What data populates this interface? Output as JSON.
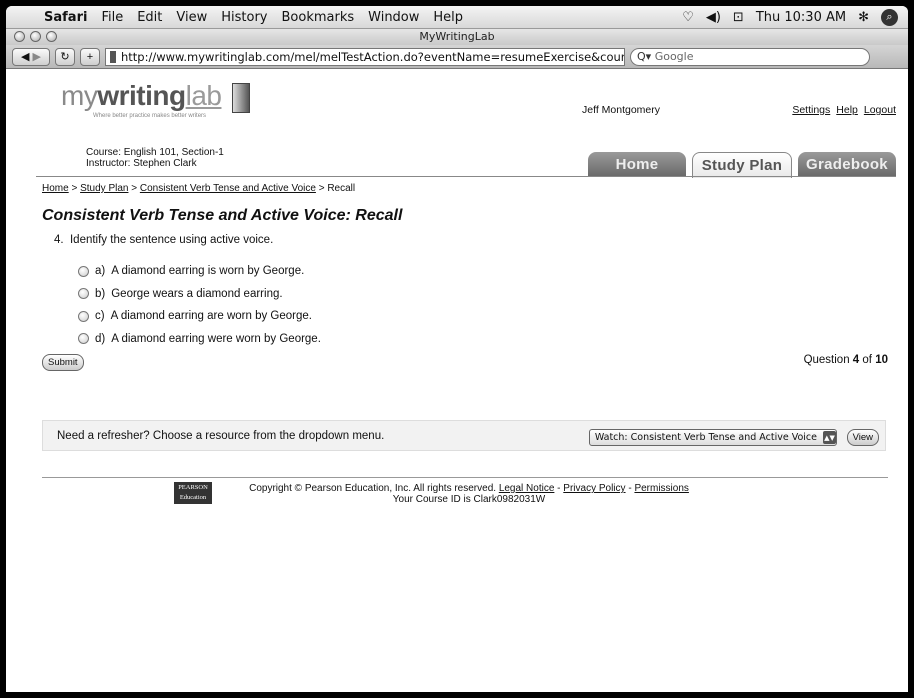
{
  "menubar": {
    "app": "Safari",
    "items": [
      "File",
      "Edit",
      "View",
      "History",
      "Bookmarks",
      "Window",
      "Help"
    ],
    "clock": "Thu 10:30 AM",
    "icons": [
      "apple-icon",
      "wifi-icon",
      "volume-icon",
      "battery-icon",
      "bluetooth-icon",
      "spotlight-icon"
    ]
  },
  "window": {
    "title": "MyWritingLab"
  },
  "toolbar": {
    "url": "http://www.mywritinglab.com/mel/melTestAction.do?eventName=resumeExercise&courseP",
    "search_placeholder": "Google"
  },
  "header": {
    "logo_my": "my",
    "logo_writing": "writing",
    "logo_lab": "lab",
    "logo_tag": "Where better practice makes better writers",
    "user": "Jeff Montgomery",
    "links": [
      "Settings",
      "Help",
      "Logout"
    ],
    "course": "Course: English 101, Section-1",
    "instructor": "Instructor: Stephen Clark"
  },
  "tabs": [
    "Home",
    "Study Plan",
    "Gradebook"
  ],
  "active_tab": "Study Plan",
  "breadcrumb": {
    "items": [
      "Home",
      "Study Plan",
      "Consistent Verb Tense and Active Voice"
    ],
    "current": "Recall",
    "separator": ">"
  },
  "page_title": "Consistent Verb Tense and Active Voice: Recall",
  "question": {
    "number": "4.",
    "text": "Identify the sentence using active voice.",
    "options": [
      {
        "letter": "a)",
        "text": "A diamond earring is worn by George."
      },
      {
        "letter": "b)",
        "text": "George wears a diamond earring."
      },
      {
        "letter": "c)",
        "text": "A diamond earring are worn by George."
      },
      {
        "letter": "d)",
        "text": "A diamond earring were worn by George."
      }
    ],
    "submit_label": "Submit",
    "counter_prefix": "Question",
    "counter_current": "4",
    "counter_of": "of",
    "counter_total": "10"
  },
  "refresher": {
    "text": "Need a refresher? Choose a resource from the dropdown menu.",
    "selected": "Watch: Consistent Verb Tense and Active Voice",
    "view_label": "View"
  },
  "footer": {
    "logo_line1": "PEARSON",
    "logo_line2": "Education",
    "copyright": "Copyright © Pearson Education, Inc. All rights reserved.",
    "links": [
      "Legal Notice",
      "Privacy Policy",
      "Permissions"
    ],
    "course_id": "Your Course ID is Clark0982031W"
  }
}
